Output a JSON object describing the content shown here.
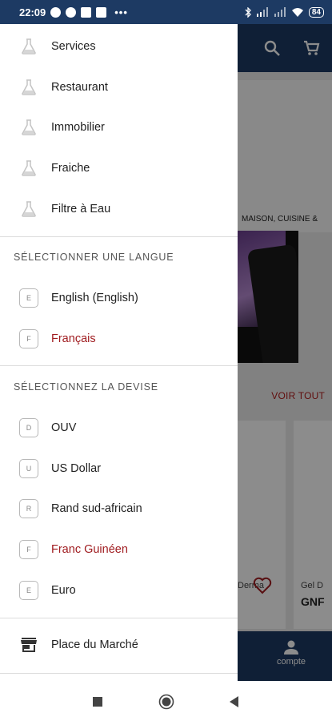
{
  "status_bar": {
    "time": "22:09",
    "battery": "84",
    "more": "•••"
  },
  "drawer": {
    "categories": [
      {
        "label": "Services",
        "icon": "flask-icon"
      },
      {
        "label": "Restaurant",
        "icon": "flask-icon"
      },
      {
        "label": "Immobilier",
        "icon": "flask-icon"
      },
      {
        "label": "Fraiche",
        "icon": "flask-icon"
      },
      {
        "label": "Filtre à Eau",
        "icon": "flask-icon"
      }
    ],
    "language_section": {
      "title": "SÉLECTIONNER UNE LANGUE",
      "items": [
        {
          "letter": "E",
          "label": "English (English)",
          "selected": false
        },
        {
          "letter": "F",
          "label": "Français",
          "selected": true
        }
      ]
    },
    "currency_section": {
      "title": "SÉLECTIONNEZ LA DEVISE",
      "items": [
        {
          "letter": "D",
          "label": "OUV",
          "selected": false
        },
        {
          "letter": "U",
          "label": "US Dollar",
          "selected": false
        },
        {
          "letter": "R",
          "label": "Rand sud-africain",
          "selected": false
        },
        {
          "letter": "F",
          "label": "Franc Guinéen",
          "selected": true
        },
        {
          "letter": "E",
          "label": "Euro",
          "selected": false
        }
      ]
    },
    "marketplace": {
      "label": "Place du Marché",
      "icon": "store-icon"
    }
  },
  "background": {
    "category_label": "MAISON, CUISINE &",
    "see_all": "VOIR TOUT",
    "products": [
      {
        "name": "Derma",
        "price": ""
      },
      {
        "name": "Gel D",
        "price": "GNF"
      }
    ],
    "bottom_nav": {
      "account_label": "compte"
    }
  },
  "colors": {
    "primary": "#1d3a63",
    "accent": "#a01c20"
  }
}
